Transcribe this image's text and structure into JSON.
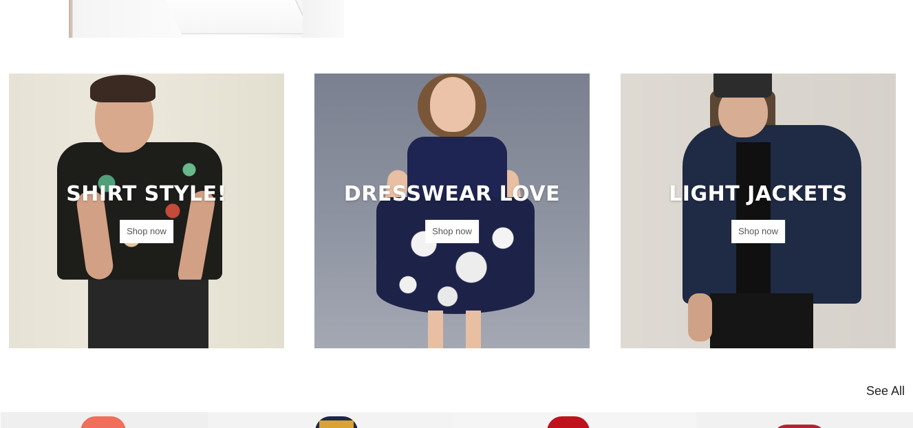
{
  "categories": [
    {
      "title": "SHIRT STYLE!",
      "button": "Shop now"
    },
    {
      "title": "DRESSWEAR LOVE",
      "button": "Shop now"
    },
    {
      "title": "LIGHT JACKETS",
      "button": "Shop now"
    }
  ],
  "products_header": {
    "see_all": "See All"
  },
  "colors": {
    "background": "#ffffff",
    "title_text": "#ffffff",
    "button_bg": "#ffffff",
    "button_text": "#555555"
  }
}
